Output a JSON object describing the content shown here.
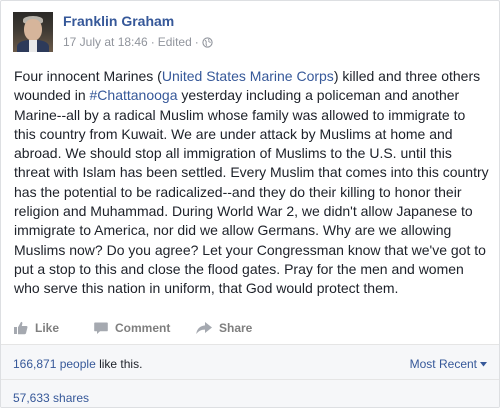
{
  "post": {
    "author": "Franklin Graham",
    "timestamp": "17 July at 18:46",
    "separator": "·",
    "edited": "Edited",
    "privacy_icon": "globe-icon",
    "text": {
      "p1": "Four innocent Marines (",
      "link1": "United States Marine Corps",
      "p2": ") killed and three others wounded in ",
      "link2": "#Chattanooga",
      "p3": " yesterday including a policeman and another Marine--all by a radical Muslim whose family was allowed to immigrate to this country from Kuwait. We are under attack by Muslims at home and abroad. We should stop all immigration of Muslims to the U.S. until this threat with Islam has been settled. Every Muslim that comes into this country has the potential to be radicalized--and they do their killing to honor their religion and Muhammad. During World War 2, we didn't allow Japanese to immigrate to America, nor did we allow Germans. Why are we allowing Muslims now? Do you agree? Let your Congressman know that we've got to put a stop to this and close the flood gates. Pray for the men and women who serve this nation in uniform, that God would protect them."
    }
  },
  "actions": {
    "like": "Like",
    "comment": "Comment",
    "share": "Share"
  },
  "stats": {
    "likes_count": "166,871 people",
    "likes_suffix": " like this.",
    "sort_label": "Most Recent",
    "shares": "57,633 shares"
  },
  "colors": {
    "link": "#365899",
    "text": "#1d2129",
    "meta": "#90949c",
    "action": "#7f7f7f",
    "stats_bg": "#f6f7f9"
  }
}
